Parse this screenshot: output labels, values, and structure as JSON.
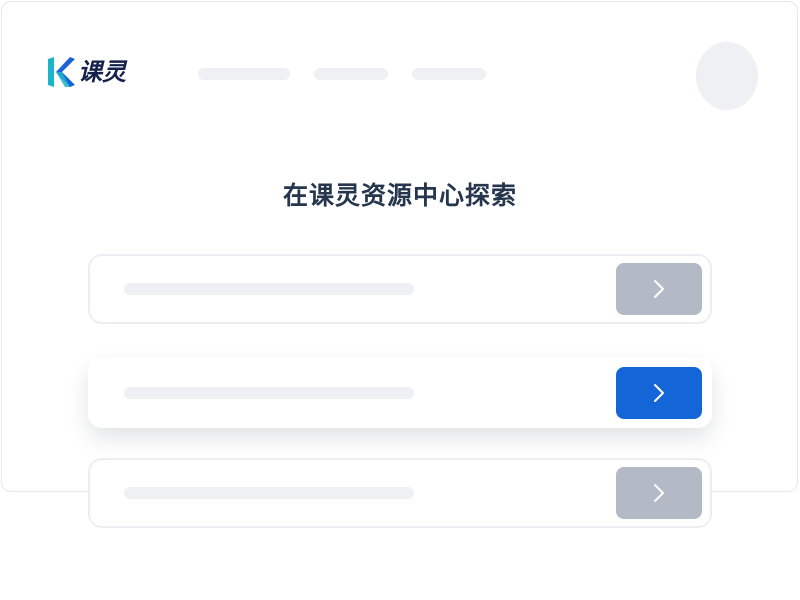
{
  "brand": {
    "name": "课灵",
    "logo_icon": "k-logo-icon",
    "colors": {
      "text": "#14204a",
      "mark_teal": "#1cb4c8",
      "mark_blue": "#1a63d6"
    }
  },
  "header": {
    "nav_placeholders": 3,
    "avatar_icon": "avatar-placeholder"
  },
  "main": {
    "title": "在课灵资源中心探索",
    "cards": [
      {
        "state": "default",
        "button_icon": "chevron-right-icon"
      },
      {
        "state": "active",
        "button_icon": "chevron-right-icon"
      },
      {
        "state": "default",
        "button_icon": "chevron-right-icon"
      }
    ]
  },
  "colors": {
    "primary": "#1466d8",
    "muted_button": "#b3b9c5",
    "placeholder": "#eef0f3",
    "heading": "#25364d"
  }
}
